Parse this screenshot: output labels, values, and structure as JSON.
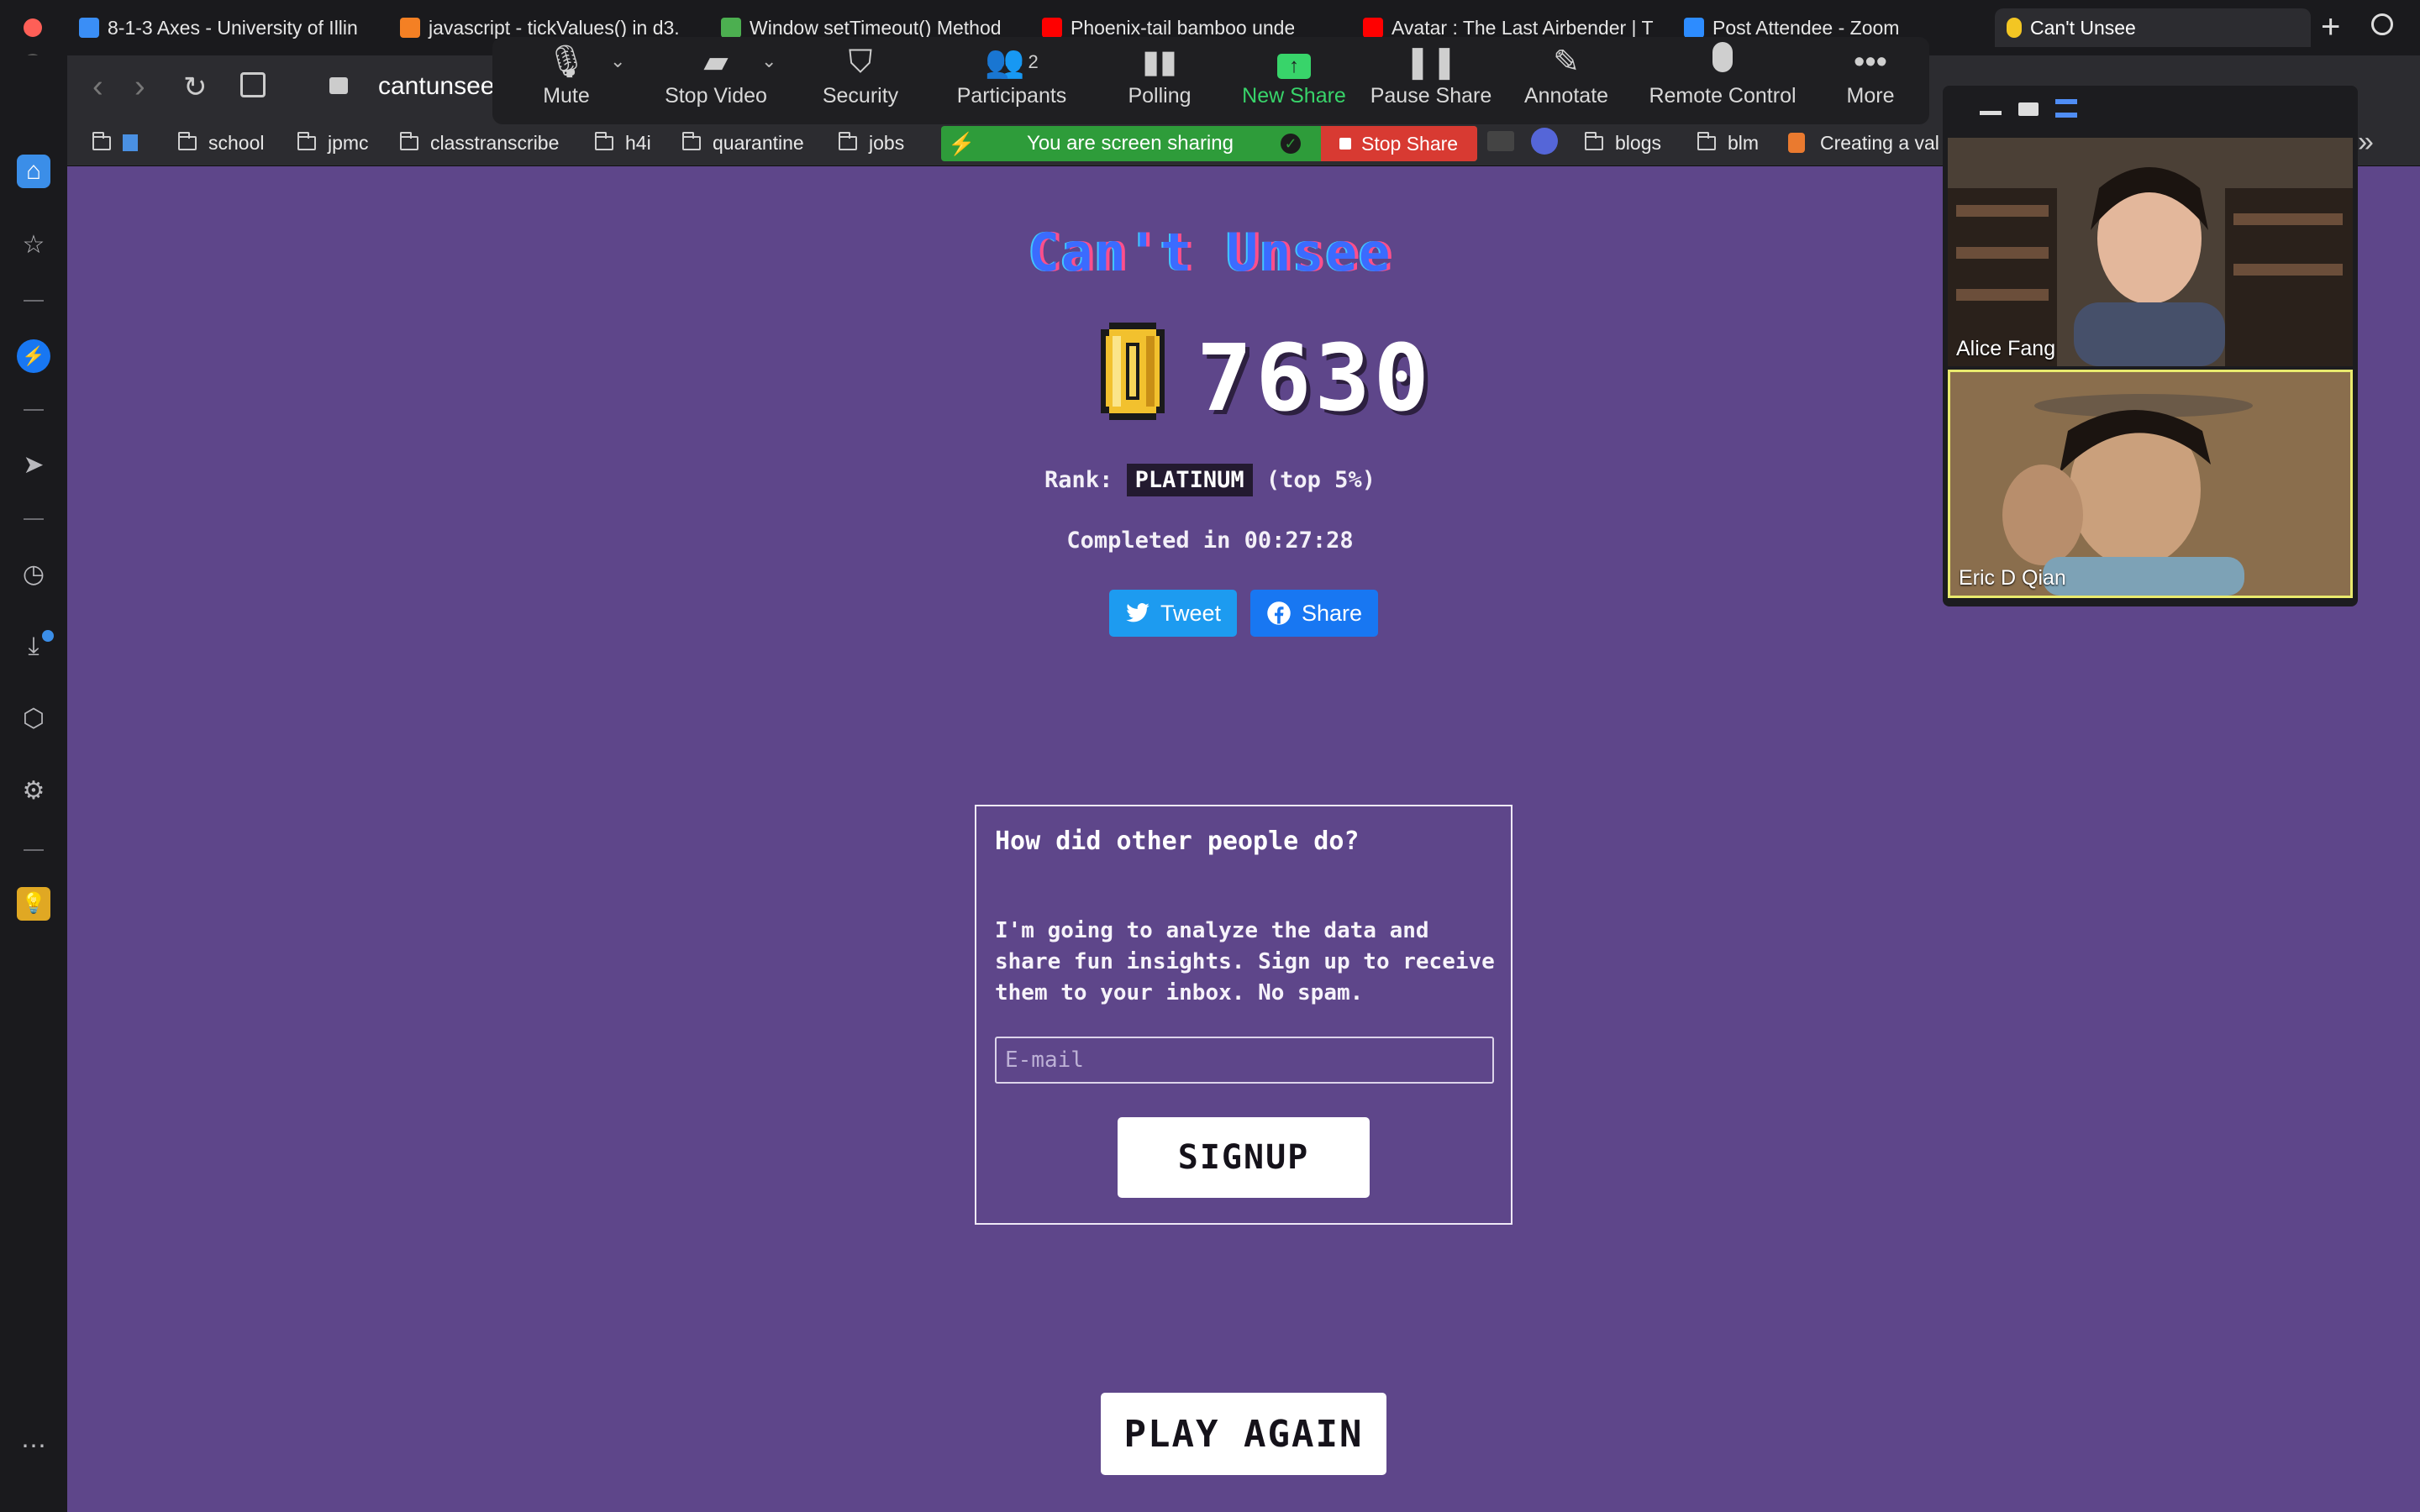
{
  "browser": {
    "tabs": [
      {
        "title": "8-1-3 Axes - University of Illin",
        "icon": "coursera-icon",
        "color": "#3a8ef6"
      },
      {
        "title": "javascript - tickValues() in d3.",
        "icon": "stackoverflow-icon",
        "color": "#f48024"
      },
      {
        "title": "Window setTimeout() Method",
        "icon": "w3schools-icon",
        "color": "#4caf50"
      },
      {
        "title": "Phoenix-tail bamboo under th",
        "icon": "youtube-icon",
        "color": "#ff0000"
      },
      {
        "title": "Avatar : The Last Airbender | T",
        "icon": "youtube-icon",
        "color": "#ff0000"
      },
      {
        "title": "Post Attendee - Zoom",
        "icon": "zoom-icon",
        "color": "#2d8cff"
      },
      {
        "title": "Can't Unsee",
        "icon": "coin-icon",
        "color": "#f3c623",
        "active": true
      }
    ],
    "address": "cantunsee",
    "bookmarks": [
      "school",
      "jpmc",
      "classtranscribe",
      "h4i",
      "quarantine",
      "jobs",
      "blogs",
      "blm",
      "Creating a val"
    ]
  },
  "zoom": {
    "toolbar": [
      {
        "label": "Mute",
        "icon": "microphone-icon"
      },
      {
        "label": "Stop Video",
        "icon": "video-camera-icon"
      },
      {
        "label": "Security",
        "icon": "shield-icon"
      },
      {
        "label": "Participants",
        "icon": "participants-icon",
        "count": "2"
      },
      {
        "label": "Polling",
        "icon": "bar-chart-icon"
      },
      {
        "label": "New Share",
        "icon": "share-screen-icon"
      },
      {
        "label": "Pause Share",
        "icon": "pause-icon"
      },
      {
        "label": "Annotate",
        "icon": "pencil-icon"
      },
      {
        "label": "Remote Control",
        "icon": "mouse-icon"
      },
      {
        "label": "More",
        "icon": "more-dots-icon"
      }
    ],
    "share_banner": "You are screen sharing",
    "stop_share": "Stop Share",
    "participants": [
      {
        "name": "Alice Fang"
      },
      {
        "name": "Eric D Qian"
      }
    ]
  },
  "game": {
    "title": "Can't Unsee",
    "score": "7630",
    "rank_label": "Rank:",
    "rank": "PLATINUM",
    "rank_suffix": "(top 5%)",
    "completed": "Completed in 00:27:28",
    "tweet": "Tweet",
    "share": "Share",
    "card_title": "How did other people do?",
    "card_body": "I'm going to analyze the data and share fun insights. Sign up to receive them to your inbox. No spam.",
    "email_placeholder": "E-mail",
    "signup": "SIGNUP",
    "play_again": "PLAY AGAIN"
  },
  "colors": {
    "page_bg": "#5e468a",
    "title_blue": "#3b6bff",
    "twitter": "#1d9bf0",
    "facebook": "#1877f2",
    "zoom_green": "#2e9c3a",
    "stop_red": "#d83a32"
  }
}
